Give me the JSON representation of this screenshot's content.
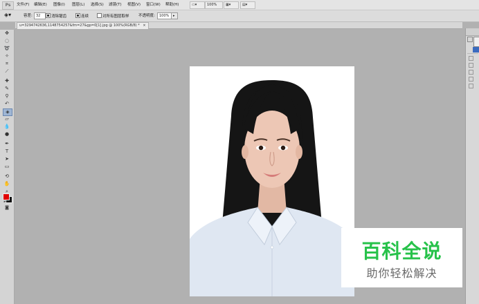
{
  "app": {
    "logo": "Ps"
  },
  "menu": [
    "文件(F)",
    "编辑(E)",
    "图像(I)",
    "图层(L)",
    "选择(S)",
    "滤镜(T)",
    "视图(V)",
    "窗口(W)",
    "帮助(H)"
  ],
  "menubar_controls": {
    "zoom": "100%"
  },
  "options": {
    "tolerance_label": "容差:",
    "tolerance_value": "32",
    "antialias_label": "消除锯齿",
    "contiguous_label": "连续",
    "all_layers_label": "对所有图层取样",
    "opacity_label": "不透明度:",
    "opacity_value": "100%"
  },
  "document": {
    "tab_title": "u=3294742636,1148754257&fm=27&gp=0[1].jpg @ 100%(RGB/8) *",
    "close": "×"
  },
  "watermark": {
    "title": "百科全说",
    "subtitle": "助你轻松解决",
    "color": "#27c24a"
  },
  "colors": {
    "foreground": "#e00000",
    "background": "#111111"
  }
}
